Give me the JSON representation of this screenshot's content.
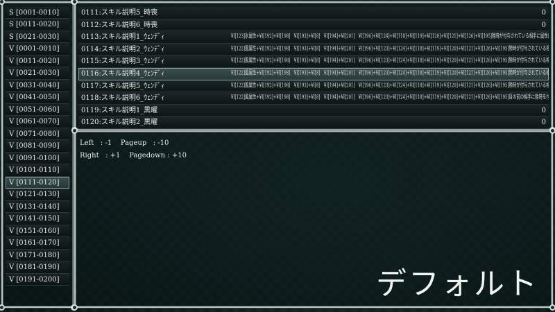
{
  "left_list": {
    "items": [
      "S [0001-0010]",
      "S [0011-0020]",
      "S [0021-0030]",
      "V [0001-0010]",
      "V [0011-0020]",
      "V [0021-0030]",
      "V [0031-0040]",
      "V [0041-0050]",
      "V [0051-0060]",
      "V [0061-0070]",
      "V [0071-0080]",
      "V [0081-0090]",
      "V [0091-0100]",
      "V [0101-0110]",
      "V [0111-0120]",
      "V [0121-0130]",
      "V [0131-0140]",
      "V [0141-0150]",
      "V [0151-0160]",
      "V [0161-0170]",
      "V [0171-0180]",
      "V [0181-0190]",
      "V [0191-0200]"
    ],
    "selected_index": 14
  },
  "variables": {
    "rows": [
      {
        "name": "0111:スキル説明5_時喪",
        "desc": "",
        "value": "0"
      },
      {
        "name": "0112:スキル説明6_時喪",
        "desc": "",
        "value": "0"
      },
      {
        "name": "0113:スキル説明1_ｳｪﾝﾃﾞｨ",
        "desc": "¥I[123]氷属性+¥I[192]+¥I[198]　¥I[193]+¥I[8]　¥I[194]+¥I[201]　¥I[196]+¥I[124]+¥I[118]+¥I[119]+¥I[120]+¥I[121]+¥I[126]+¥I[195]隙時が付与されている相手に属性反応と爆撃が発生します。",
        "value": ""
      },
      {
        "name": "0114:スキル説明2_ｳｪﾝﾃﾞｨ",
        "desc": "¥I[122]風属性+¥I[192]+¥I[198]　¥I[193]+¥I[8]　¥I[194]+¥I[201]　¥I[196]+¥I[123]+¥I[124]+¥I[118]+¥I[119]+¥I[120]+¥I[121]+¥I[126]+¥I[195]隙時が付与されている相手に属性反応と爆撃が発生します。¥I[8]隙時のレベルを1段階上昇させます。",
        "value": ""
      },
      {
        "name": "0115:スキル説明3_ｳｪﾝﾃﾞｨ",
        "desc": "¥I[122]風属性+¥I[192]+¥I[198]　¥I[193]+¥I[8]　¥I[194]+¥I[201]　¥I[196]+¥I[123]+¥I[124]+¥I[118]+¥I[119]+¥I[120]+¥I[121]+¥I[126]+¥I[195]隙時が付与されている相手に属性反応と爆撃が発生します。¥I[8]隙時のレベルを1段階上昇させます。",
        "value": ""
      },
      {
        "name": "0116:スキル説明4_ｳｪﾝﾃﾞｨ",
        "desc": "¥I[122]風属性+¥I[192]+¥I[198]　¥I[193]+¥I[8]　¥I[194]+¥I[201]　¥I[196]+¥I[123]+¥I[124]+¥I[118]+¥I[119]+¥I[120]+¥I[121]+¥I[126]+¥I[195]隙時が付与されている相手に属性反応と爆撃が発生します。",
        "value": ""
      },
      {
        "name": "0117:スキル説明5_ｳｪﾝﾃﾞｨ",
        "desc": "¥I[122]風属性+¥I[192]+¥I[198]　¥I[193]+¥I[8]　¥I[194]+¥I[201]　¥I[196]+¥I[123]+¥I[124]+¥I[118]+¥I[119]+¥I[120]+¥I[121]+¥I[126]+¥I[195]隙時が付与されている相手に属性反応と爆撃が発生します。¥I[8]隙時のレベルを1段階上昇させます。",
        "value": ""
      },
      {
        "name": "0118:スキル説明6_ｳｪﾝﾃﾞｨ",
        "desc": "¥I[122]風属性+¥I[192]+¥I[198]　¥I[193]+¥I[8]　¥I[194]+¥I[201]　¥I[196]+¥I[123]+¥I[124]+¥I[118]+¥I[119]+¥I[120]+¥I[121]+¥I[126]+¥I[195]目の前の相手に隙時を付与させる。¥I[8]属性反応を起こす。",
        "value": ""
      },
      {
        "name": "0119:スキル説明1_黒曜",
        "desc": "",
        "value": "0"
      },
      {
        "name": "0120:スキル説明2_黒曜",
        "desc": "",
        "value": "0"
      }
    ],
    "selected_index": 5
  },
  "help": {
    "line1": "Left   : -1    Pageup   : -10",
    "line2": "Right   : +1    Pagedown : +10"
  },
  "mode_label": "デフォルト"
}
